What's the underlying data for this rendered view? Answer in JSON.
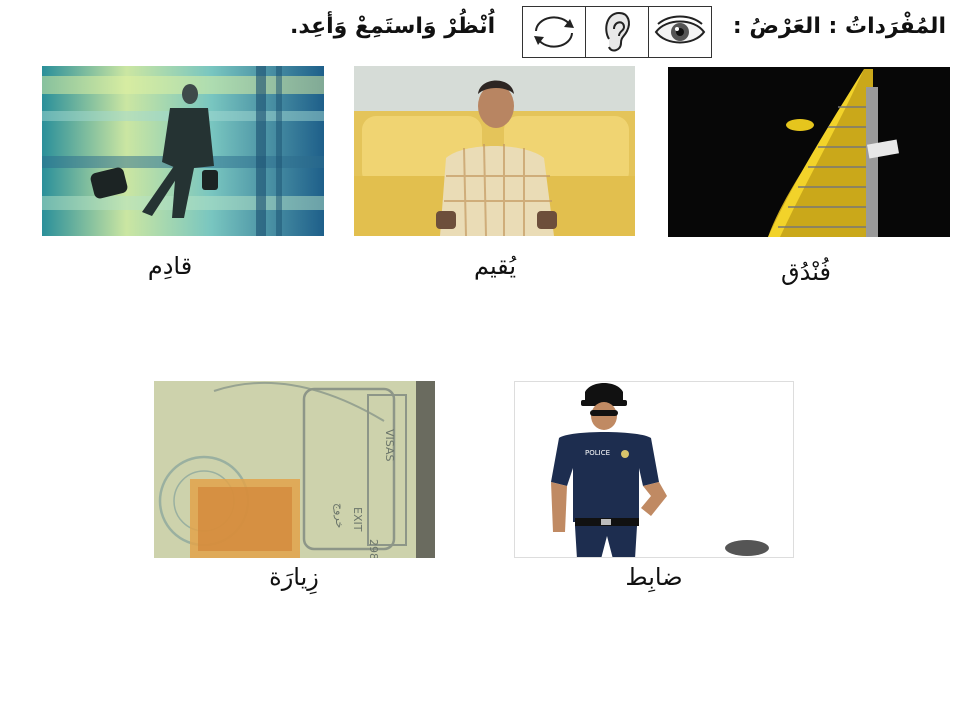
{
  "header": {
    "title": "المُفْرَداتُ : العَرْضُ :",
    "instruction": "اُنْظُرْ وَاستَمِعْ وَأعِد.",
    "icons": [
      "cycle-arrows-icon",
      "ear-icon",
      "eye-icon"
    ]
  },
  "cards": [
    {
      "id": "hotel",
      "caption": "فُنْدُق",
      "image": "hotel-tower-photo"
    },
    {
      "id": "resides",
      "caption": "يُقيم",
      "image": "seated-man-photo"
    },
    {
      "id": "arriving",
      "caption": "قادِم",
      "image": "traveler-photo"
    },
    {
      "id": "officer",
      "caption": "ضابِط",
      "image": "police-officer-photo"
    },
    {
      "id": "visit",
      "caption": "زِيارَة",
      "image": "passport-stamps-photo"
    }
  ],
  "stamp_text": {
    "visas": "VISAS",
    "exit": "EXIT",
    "exit_ar": "خروج",
    "number": "298",
    "police": "POLICE"
  }
}
